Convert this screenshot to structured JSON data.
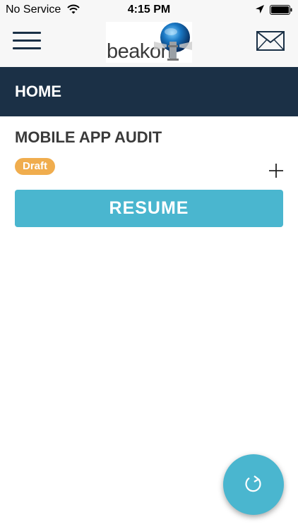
{
  "status_bar": {
    "carrier": "No Service",
    "time": "4:15 PM",
    "icons": [
      "wifi-icon",
      "location-arrow-icon",
      "battery-icon"
    ]
  },
  "header": {
    "logo_text": "beakon",
    "icons": [
      "menu-icon",
      "mail-icon"
    ]
  },
  "nav": {
    "title": "HOME"
  },
  "audit": {
    "title": "MOBILE APP AUDIT",
    "status": "Draft",
    "resume_label": "RESUME"
  },
  "colors": {
    "nav_bg": "#1b3046",
    "accent": "#4ab6cf",
    "draft_badge": "#f0ad4e",
    "header_bg": "#f7f7f7"
  }
}
